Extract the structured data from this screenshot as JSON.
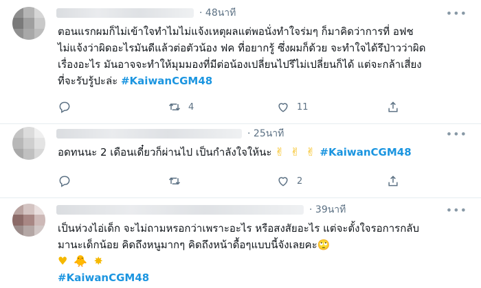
{
  "tweets": [
    {
      "time": "48นาที",
      "lines": [
        "ตอนแรกผมก็ไม่เข้าใจทำไมไม่แจ้งเหตุผลแต่พอนั่งทำใจร่มๆ ก็มาคิดว่าการที่ อฟช",
        "ไม่แจ้งว่าผิดอะไรมันดีแล้วต่อตัวน้อง ฟค ที่อยากรู้ ซึ่งผมก็ด้วย จะทำใจได้รึป่าวว่าผิด",
        "เรื่องอะไร มันอาจจะทำให้มุมมองที่มีต่อน้องเปลี่ยนไปรึไม่เปลี่ยนก็ได้ แต่จะกล้าเสี่ยง",
        "ที่จะรับรู้ปะล่ะ"
      ],
      "hashtag": "#KaiwanCGM48",
      "retweets": "4",
      "likes": "11"
    },
    {
      "time": "25นาที",
      "line": "อดทนนะ 2 เดือนเดี๋ยวก็ผ่านไป เป็นกำลังใจให้นะ",
      "emojis": "✌ ✌ ✌",
      "hashtag": "#KaiwanCGM48",
      "retweets": "",
      "likes": "2"
    },
    {
      "time": "39นาที",
      "lines": [
        "เป็นห่วงไอ่เด็ก จะไม่ถามหรอกว่าเพราะอะไร หรือสงสัยอะไร แต่จะตั้งใจรอการกลับ",
        "มานะเด็กน้อย คิดถึงหนูมากๆ คิดถึงหน้าดื้อๆแบบนี้จังเลยคะ"
      ],
      "emoji_end": "🙄",
      "emojis": "♥ 🐥 ✸",
      "hashtag": "#KaiwanCGM48"
    }
  ],
  "colors": {
    "hashtag": "#1b95e0",
    "meta": "#5b7083",
    "divider": "#e6ecf0"
  },
  "icons": [
    "more-icon",
    "reply-icon",
    "retweet-icon",
    "like-icon",
    "share-icon"
  ]
}
